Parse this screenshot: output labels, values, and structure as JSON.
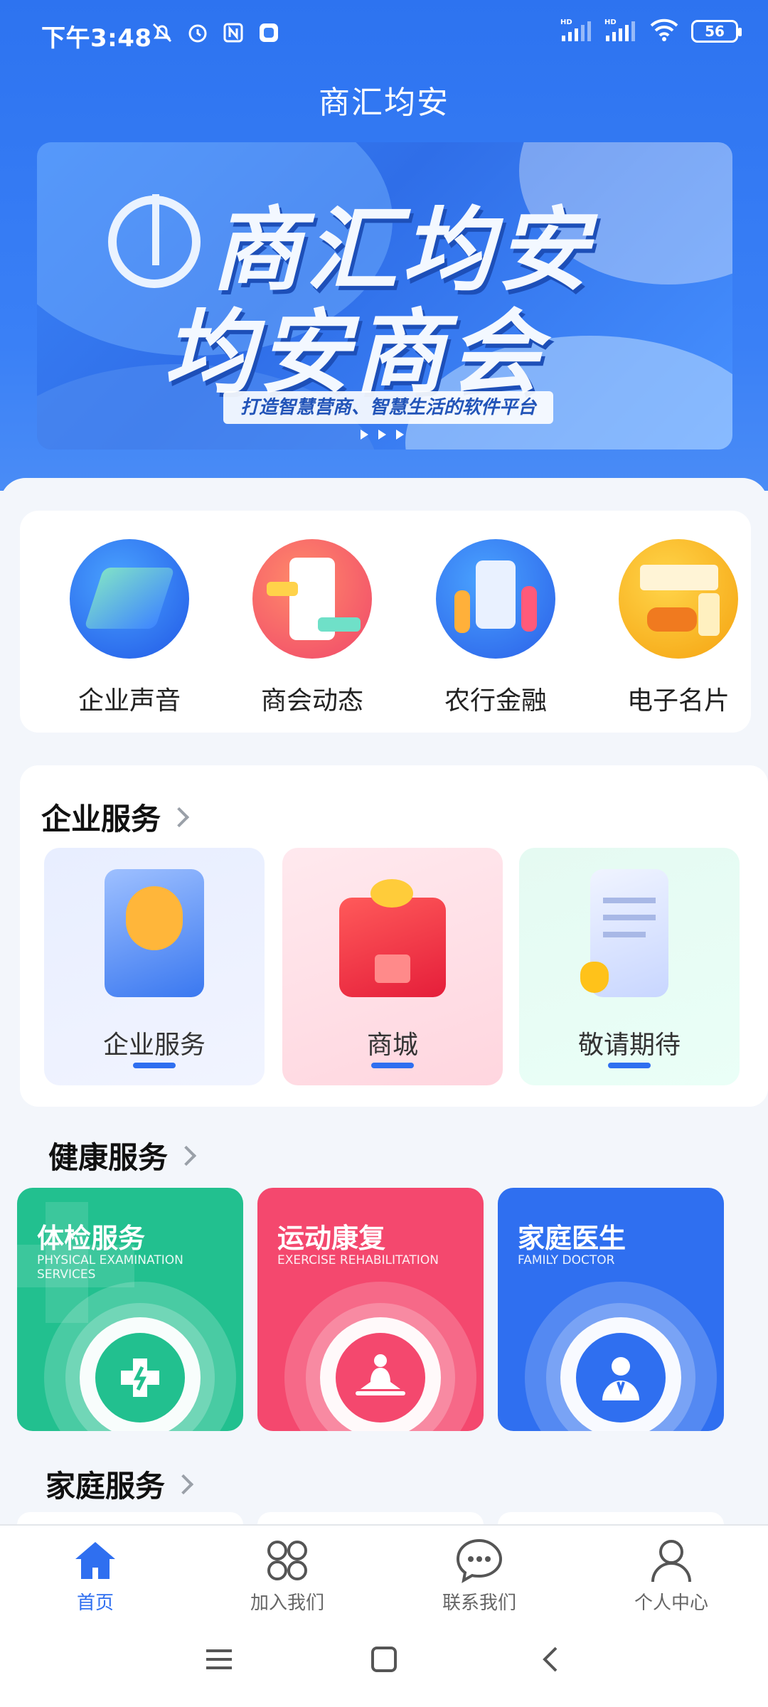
{
  "status_bar": {
    "time": "下午3:48",
    "battery": "56",
    "signal_tag_1": "HD",
    "signal_tag_2": "HD"
  },
  "app": {
    "title": "商汇均安"
  },
  "banner": {
    "line1": "商汇均安",
    "line2": "均安商会",
    "slogan": "打造智慧营商、智慧生活的软件平台"
  },
  "quick_links": [
    {
      "label": "企业声音",
      "icon": "enterprise-voice-icon"
    },
    {
      "label": "商会动态",
      "icon": "chamber-news-icon"
    },
    {
      "label": "农行金融",
      "icon": "abc-finance-icon"
    },
    {
      "label": "电子名片",
      "icon": "e-card-icon"
    }
  ],
  "enterprise_section": {
    "title": "企业服务",
    "items": [
      {
        "label": "企业服务"
      },
      {
        "label": "商城"
      },
      {
        "label": "敬请期待"
      }
    ]
  },
  "health_section": {
    "title": "健康服务",
    "items": [
      {
        "title": "体检服务",
        "subtitle": "PHYSICAL EXAMINATION SERVICES",
        "color": "#22c08f"
      },
      {
        "title": "运动康复",
        "subtitle": "EXERCISE REHABILITATION",
        "color": "#f4486e"
      },
      {
        "title": "家庭医生",
        "subtitle": "FAMILY DOCTOR",
        "color": "#2f6ff0"
      }
    ]
  },
  "family_section": {
    "title": "家庭服务"
  },
  "bottom_nav": [
    {
      "label": "首页",
      "icon": "home-icon",
      "active": true
    },
    {
      "label": "加入我们",
      "icon": "grid-icon",
      "active": false
    },
    {
      "label": "联系我们",
      "icon": "chat-icon",
      "active": false
    },
    {
      "label": "个人中心",
      "icon": "user-icon",
      "active": false
    }
  ],
  "colors": {
    "primary": "#2f6ff0",
    "header": "#3a80f6"
  }
}
